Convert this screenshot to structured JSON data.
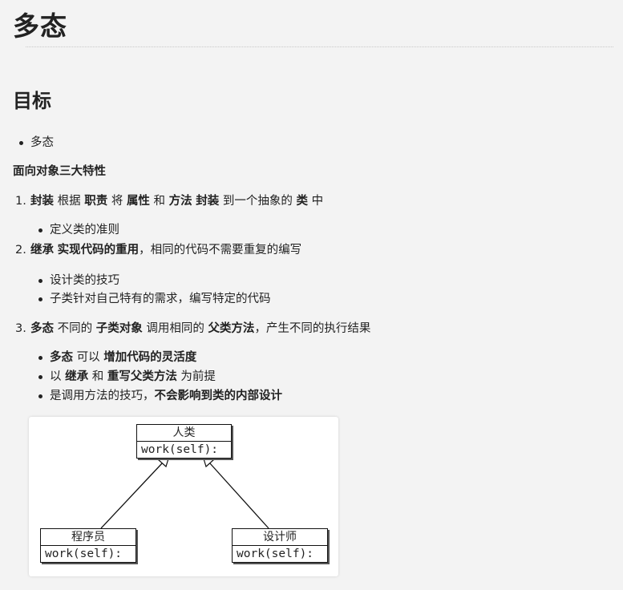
{
  "title": "多态",
  "section": "目标",
  "goal_bullet": "多态",
  "oop_heading": "面向对象三大特性",
  "items": [
    {
      "number": "1.",
      "segments": [
        {
          "t": "封装",
          "b": true
        },
        {
          "t": " 根据 ",
          "b": false
        },
        {
          "t": "职责",
          "b": true
        },
        {
          "t": " 将 ",
          "b": false
        },
        {
          "t": "属性",
          "b": true
        },
        {
          "t": " 和 ",
          "b": false
        },
        {
          "t": "方法",
          "b": true
        },
        {
          "t": " ",
          "b": false
        },
        {
          "t": "封装",
          "b": true
        },
        {
          "t": " 到一个抽象的 ",
          "b": false
        },
        {
          "t": "类",
          "b": true
        },
        {
          "t": " 中",
          "b": false
        }
      ],
      "subs": [
        "定义类的准则"
      ]
    },
    {
      "number": "2.",
      "segments": [
        {
          "t": "继承",
          "b": true
        },
        {
          "t": " ",
          "b": false
        },
        {
          "t": "实现代码的重用",
          "b": true
        },
        {
          "t": "，相同的代码不需要重复的编写",
          "b": false
        }
      ],
      "subs": [
        "设计类的技巧",
        "子类针对自己特有的需求，编写特定的代码"
      ]
    },
    {
      "number": "3.",
      "segments": [
        {
          "t": "多态",
          "b": true
        },
        {
          "t": " 不同的 ",
          "b": false
        },
        {
          "t": "子类对象",
          "b": true
        },
        {
          "t": " 调用相同的 ",
          "b": false
        },
        {
          "t": "父类方法",
          "b": true
        },
        {
          "t": "，产生不同的执行结果",
          "b": false
        }
      ],
      "subs_rich": [
        [
          {
            "t": "多态",
            "b": true
          },
          {
            "t": " 可以 ",
            "b": false
          },
          {
            "t": "增加代码的灵活度",
            "b": true
          }
        ],
        [
          {
            "t": "以 ",
            "b": false
          },
          {
            "t": "继承",
            "b": true
          },
          {
            "t": " 和 ",
            "b": false
          },
          {
            "t": "重写父类方法",
            "b": true
          },
          {
            "t": " 为前提",
            "b": false
          }
        ],
        [
          {
            "t": "是调用方法的技巧，",
            "b": false
          },
          {
            "t": "不会影响到类的内部设计",
            "b": true
          }
        ]
      ]
    }
  ],
  "diagram": {
    "parent": {
      "name": "人类",
      "method": "work(self):"
    },
    "children": [
      {
        "name": "程序员",
        "method": "work(self):"
      },
      {
        "name": "设计师",
        "method": "work(self):"
      }
    ]
  }
}
